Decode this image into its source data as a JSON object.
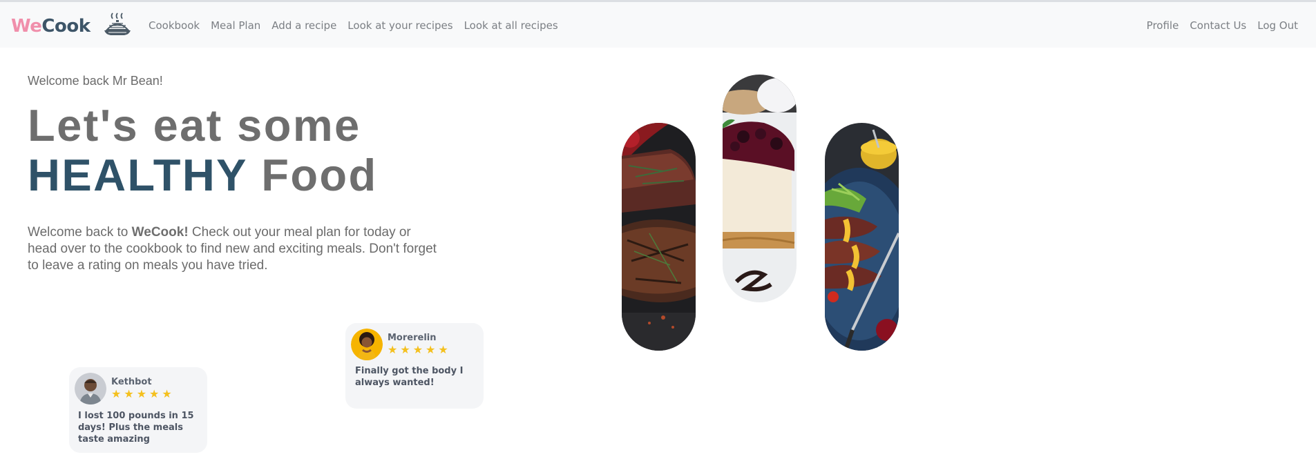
{
  "navbar": {
    "brand_part1": "We",
    "brand_part2": "Cook",
    "left_links": [
      "Cookbook",
      "Meal Plan",
      "Add a recipe",
      "Look at your recipes",
      "Look at all recipes"
    ],
    "right_links": [
      "Profile",
      "Contact Us",
      "Log Out"
    ]
  },
  "hero": {
    "welcome": "Welcome back Mr Bean!",
    "headline_line1": "Let's eat some",
    "headline_highlight": "HEALTHY",
    "headline_rest": " Food",
    "intro_prefix": "Welcome back to ",
    "intro_brand": "WeCook!",
    "intro_suffix": " Check out your meal plan for today or head over to the cookbook to find new and exciting meals. Don't forget to leave a rating on meals you have tried."
  },
  "reviews": [
    {
      "name": "Morerelin",
      "rating": 5,
      "text": "Finally got the body I always wanted!"
    },
    {
      "name": "Kethbot",
      "rating": 5,
      "text": "I lost 100 pounds in 15 days! Plus the meals taste amazing"
    }
  ],
  "food_images": [
    "steak",
    "cheesecake",
    "sliced-duck-breast"
  ],
  "colors": {
    "brand_pink": "#f08fab",
    "brand_navy": "#3d5568",
    "healthy": "#2f5268",
    "star": "#f4c01e"
  }
}
